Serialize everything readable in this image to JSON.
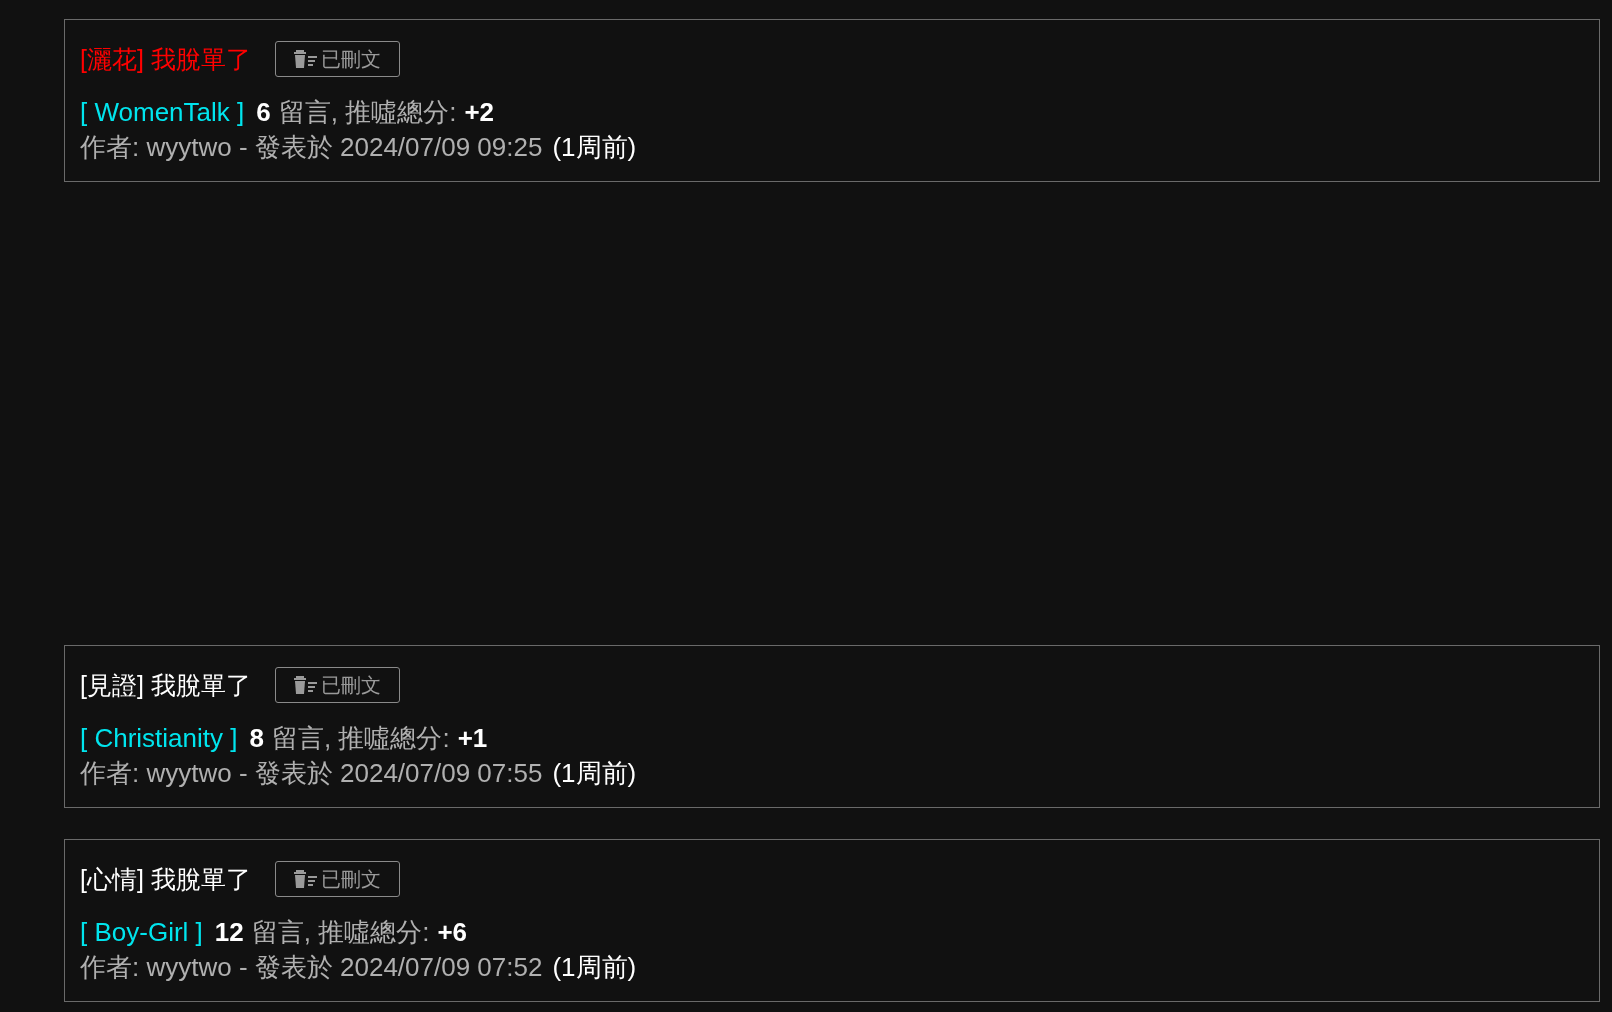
{
  "posts": [
    {
      "title": "[灑花] 我脫單了",
      "color": "#ff0000",
      "deleted_label": "已刪文",
      "board": "[ WomenTalk ]",
      "count": "6",
      "count_label": "留言, 推噓總分:",
      "score": "+2",
      "byline": "作者: wyytwo - 發表於 2024/07/09 09:25",
      "age": "(1周前)"
    },
    {
      "title": "[見證] 我脫單了",
      "color": "#ffffff",
      "deleted_label": "已刪文",
      "board": "[ Christianity ]",
      "count": "8",
      "count_label": "留言, 推噓總分:",
      "score": "+1",
      "byline": "作者: wyytwo - 發表於 2024/07/09 07:55",
      "age": "(1周前)"
    },
    {
      "title": "[心情] 我脫單了",
      "color": "#ffffff",
      "deleted_label": "已刪文",
      "board": "[ Boy-Girl ]",
      "count": "12",
      "count_label": "留言, 推噓總分:",
      "score": "+6",
      "byline": "作者: wyytwo - 發表於 2024/07/09 07:52",
      "age": "(1周前)"
    }
  ]
}
